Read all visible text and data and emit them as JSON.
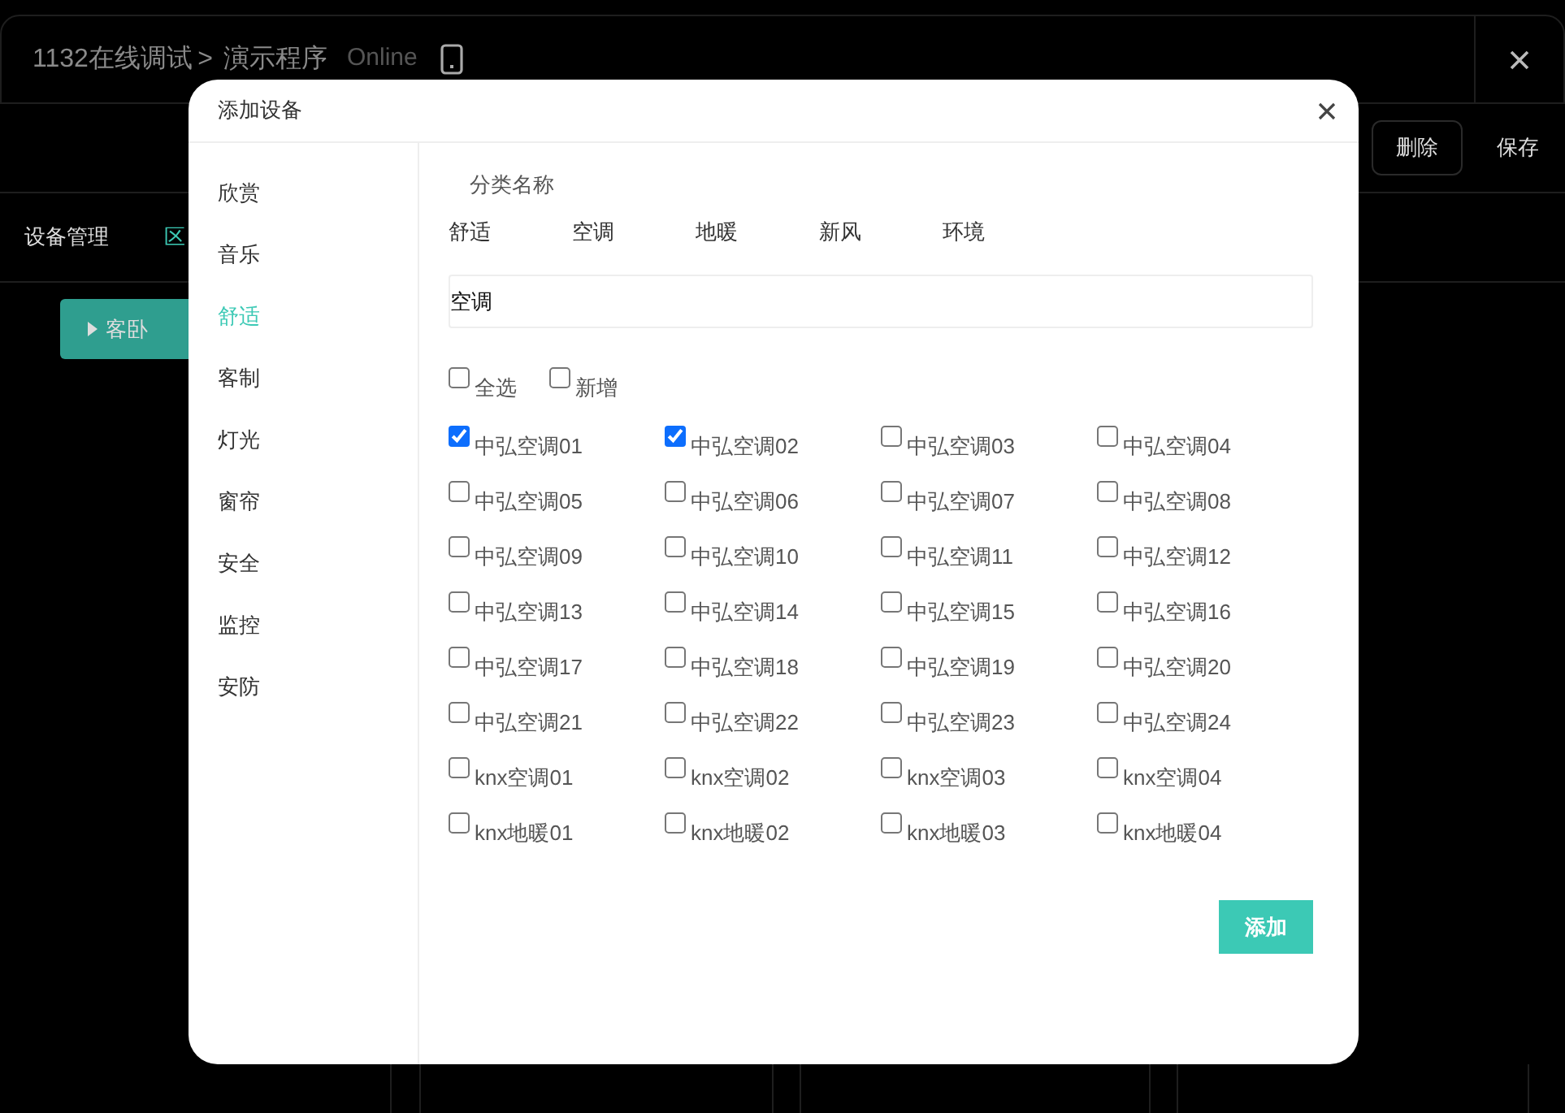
{
  "app": {
    "breadcrumb": [
      "1132在线调试",
      "演示程序"
    ],
    "breadcrumb_separator": ">",
    "status": "Online",
    "toolbar": [
      "删除",
      "保存"
    ],
    "tabs": [
      {
        "label": "设备管理",
        "selected": false
      },
      {
        "label": "区",
        "selected": true
      }
    ],
    "room_button": "客卧"
  },
  "dialog": {
    "title": "添加设备",
    "categories": [
      {
        "label": "欣赏",
        "selected": false
      },
      {
        "label": "音乐",
        "selected": false
      },
      {
        "label": "舒适",
        "selected": true
      },
      {
        "label": "客制",
        "selected": false
      },
      {
        "label": "灯光",
        "selected": false
      },
      {
        "label": "窗帘",
        "selected": false
      },
      {
        "label": "安全",
        "selected": false
      },
      {
        "label": "监控",
        "selected": false
      },
      {
        "label": "安防",
        "selected": false
      }
    ],
    "category_label": "分类名称",
    "subcategories": [
      "舒适",
      "空调",
      "地暖",
      "新风",
      "环境"
    ],
    "name_field": {
      "value": "空调"
    },
    "options": [
      {
        "label": "全选",
        "checked": false
      },
      {
        "label": "新增",
        "checked": false
      }
    ],
    "devices": [
      {
        "label": "中弘空调01",
        "checked": true
      },
      {
        "label": "中弘空调02",
        "checked": true
      },
      {
        "label": "中弘空调03",
        "checked": false
      },
      {
        "label": "中弘空调04",
        "checked": false
      },
      {
        "label": "中弘空调05",
        "checked": false
      },
      {
        "label": "中弘空调06",
        "checked": false
      },
      {
        "label": "中弘空调07",
        "checked": false
      },
      {
        "label": "中弘空调08",
        "checked": false
      },
      {
        "label": "中弘空调09",
        "checked": false
      },
      {
        "label": "中弘空调10",
        "checked": false
      },
      {
        "label": "中弘空调11",
        "checked": false
      },
      {
        "label": "中弘空调12",
        "checked": false
      },
      {
        "label": "中弘空调13",
        "checked": false
      },
      {
        "label": "中弘空调14",
        "checked": false
      },
      {
        "label": "中弘空调15",
        "checked": false
      },
      {
        "label": "中弘空调16",
        "checked": false
      },
      {
        "label": "中弘空调17",
        "checked": false
      },
      {
        "label": "中弘空调18",
        "checked": false
      },
      {
        "label": "中弘空调19",
        "checked": false
      },
      {
        "label": "中弘空调20",
        "checked": false
      },
      {
        "label": "中弘空调21",
        "checked": false
      },
      {
        "label": "中弘空调22",
        "checked": false
      },
      {
        "label": "中弘空调23",
        "checked": false
      },
      {
        "label": "中弘空调24",
        "checked": false
      },
      {
        "label": "knx空调01",
        "checked": false
      },
      {
        "label": "knx空调02",
        "checked": false
      },
      {
        "label": "knx空调03",
        "checked": false
      },
      {
        "label": "knx空调04",
        "checked": false
      },
      {
        "label": "knx地暖01",
        "checked": false
      },
      {
        "label": "knx地暖02",
        "checked": false
      },
      {
        "label": "knx地暖03",
        "checked": false
      },
      {
        "label": "knx地暖04",
        "checked": false
      }
    ],
    "add_button": "添加"
  }
}
